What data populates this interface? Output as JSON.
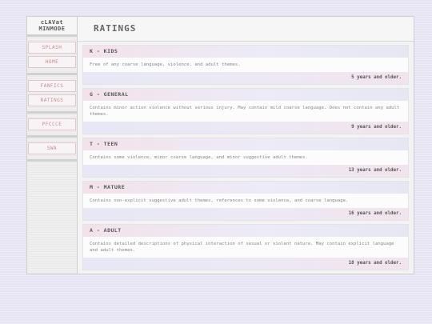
{
  "sidebar": {
    "logo_line1": "cLAVat",
    "logo_line2": "MINMODE",
    "groups": [
      {
        "items": [
          {
            "label": "SPLASH"
          },
          {
            "label": "HOME"
          }
        ]
      },
      {
        "items": [
          {
            "label": "FANFICS"
          },
          {
            "label": "RATINGS"
          }
        ]
      },
      {
        "items": [
          {
            "label": "PFCCCE"
          }
        ]
      },
      {
        "items": [
          {
            "label": "SWA"
          }
        ]
      }
    ]
  },
  "header": {
    "title": "RATINGS"
  },
  "ratings": [
    {
      "title": "K - KIDS",
      "description": "Free of any coarse language, violence, and adult themes.",
      "age": "5 years and older."
    },
    {
      "title": "G - GENERAL",
      "description": "Contains minor action violence without serious injury. May contain mild coarse language. Does not contain any adult themes.",
      "age": "9 years and older."
    },
    {
      "title": "T - TEEN",
      "description": "Contains some violence, minor coarse language, and minor suggestive adult themes.",
      "age": "13 years and older."
    },
    {
      "title": "M - MATURE",
      "description": "Contains non-explicit suggestive adult themes, references to some violence, and coarse language.",
      "age": "16 years and older."
    },
    {
      "title": "A - ADULT",
      "description": "Contains detailed descriptions of physical interaction of sexual or violent nature. May contain explicit language and adult themes.",
      "age": "18 years and older."
    }
  ]
}
